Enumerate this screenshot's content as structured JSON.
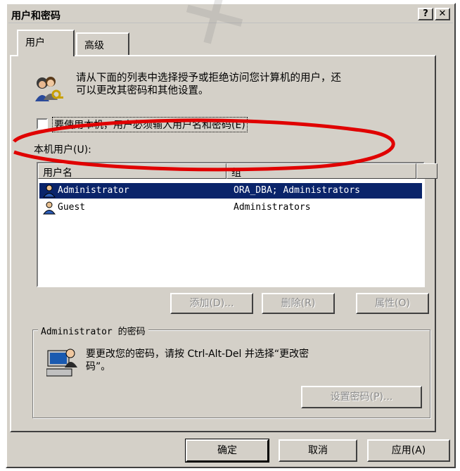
{
  "window": {
    "title": "用户和密码",
    "help_label": "?",
    "close_label": "✕"
  },
  "tabs": [
    {
      "label": "用户"
    },
    {
      "label": "高级"
    }
  ],
  "intro": {
    "text_line1": "请从下面的列表中选择授予或拒绝访问您计算机的用户，还",
    "text_line2": "可以更改其密码和其他设置。",
    "icon": "users-keys-icon"
  },
  "require_login": {
    "label": "要使用本机，用户必须输入用户名和密码(E)",
    "checked": false
  },
  "local_users": {
    "label": "本机用户(U):",
    "columns": [
      "用户名",
      "组"
    ],
    "rows": [
      {
        "name": "Administrator",
        "group": "ORA_DBA; Administrators",
        "selected": true,
        "icon": "user-icon"
      },
      {
        "name": "Guest",
        "group": "Administrators",
        "selected": false,
        "icon": "user-icon"
      }
    ]
  },
  "user_buttons": {
    "add": "添加(D)...",
    "remove": "删除(R)",
    "properties": "属性(O)"
  },
  "password_group": {
    "title": "Administrator 的密码",
    "text_line1": "要更改您的密码，请按 Ctrl-Alt-Del 并选择“更改密",
    "text_line2": "码”。",
    "icon": "computer-user-icon",
    "set_password": "设置密码(P)..."
  },
  "footer": {
    "ok": "确定",
    "cancel": "取消",
    "apply": "应用(A)"
  },
  "colors": {
    "dialog_bg": "#d4d0c8",
    "selection": "#0a246a",
    "annotation_red": "#e00000"
  }
}
